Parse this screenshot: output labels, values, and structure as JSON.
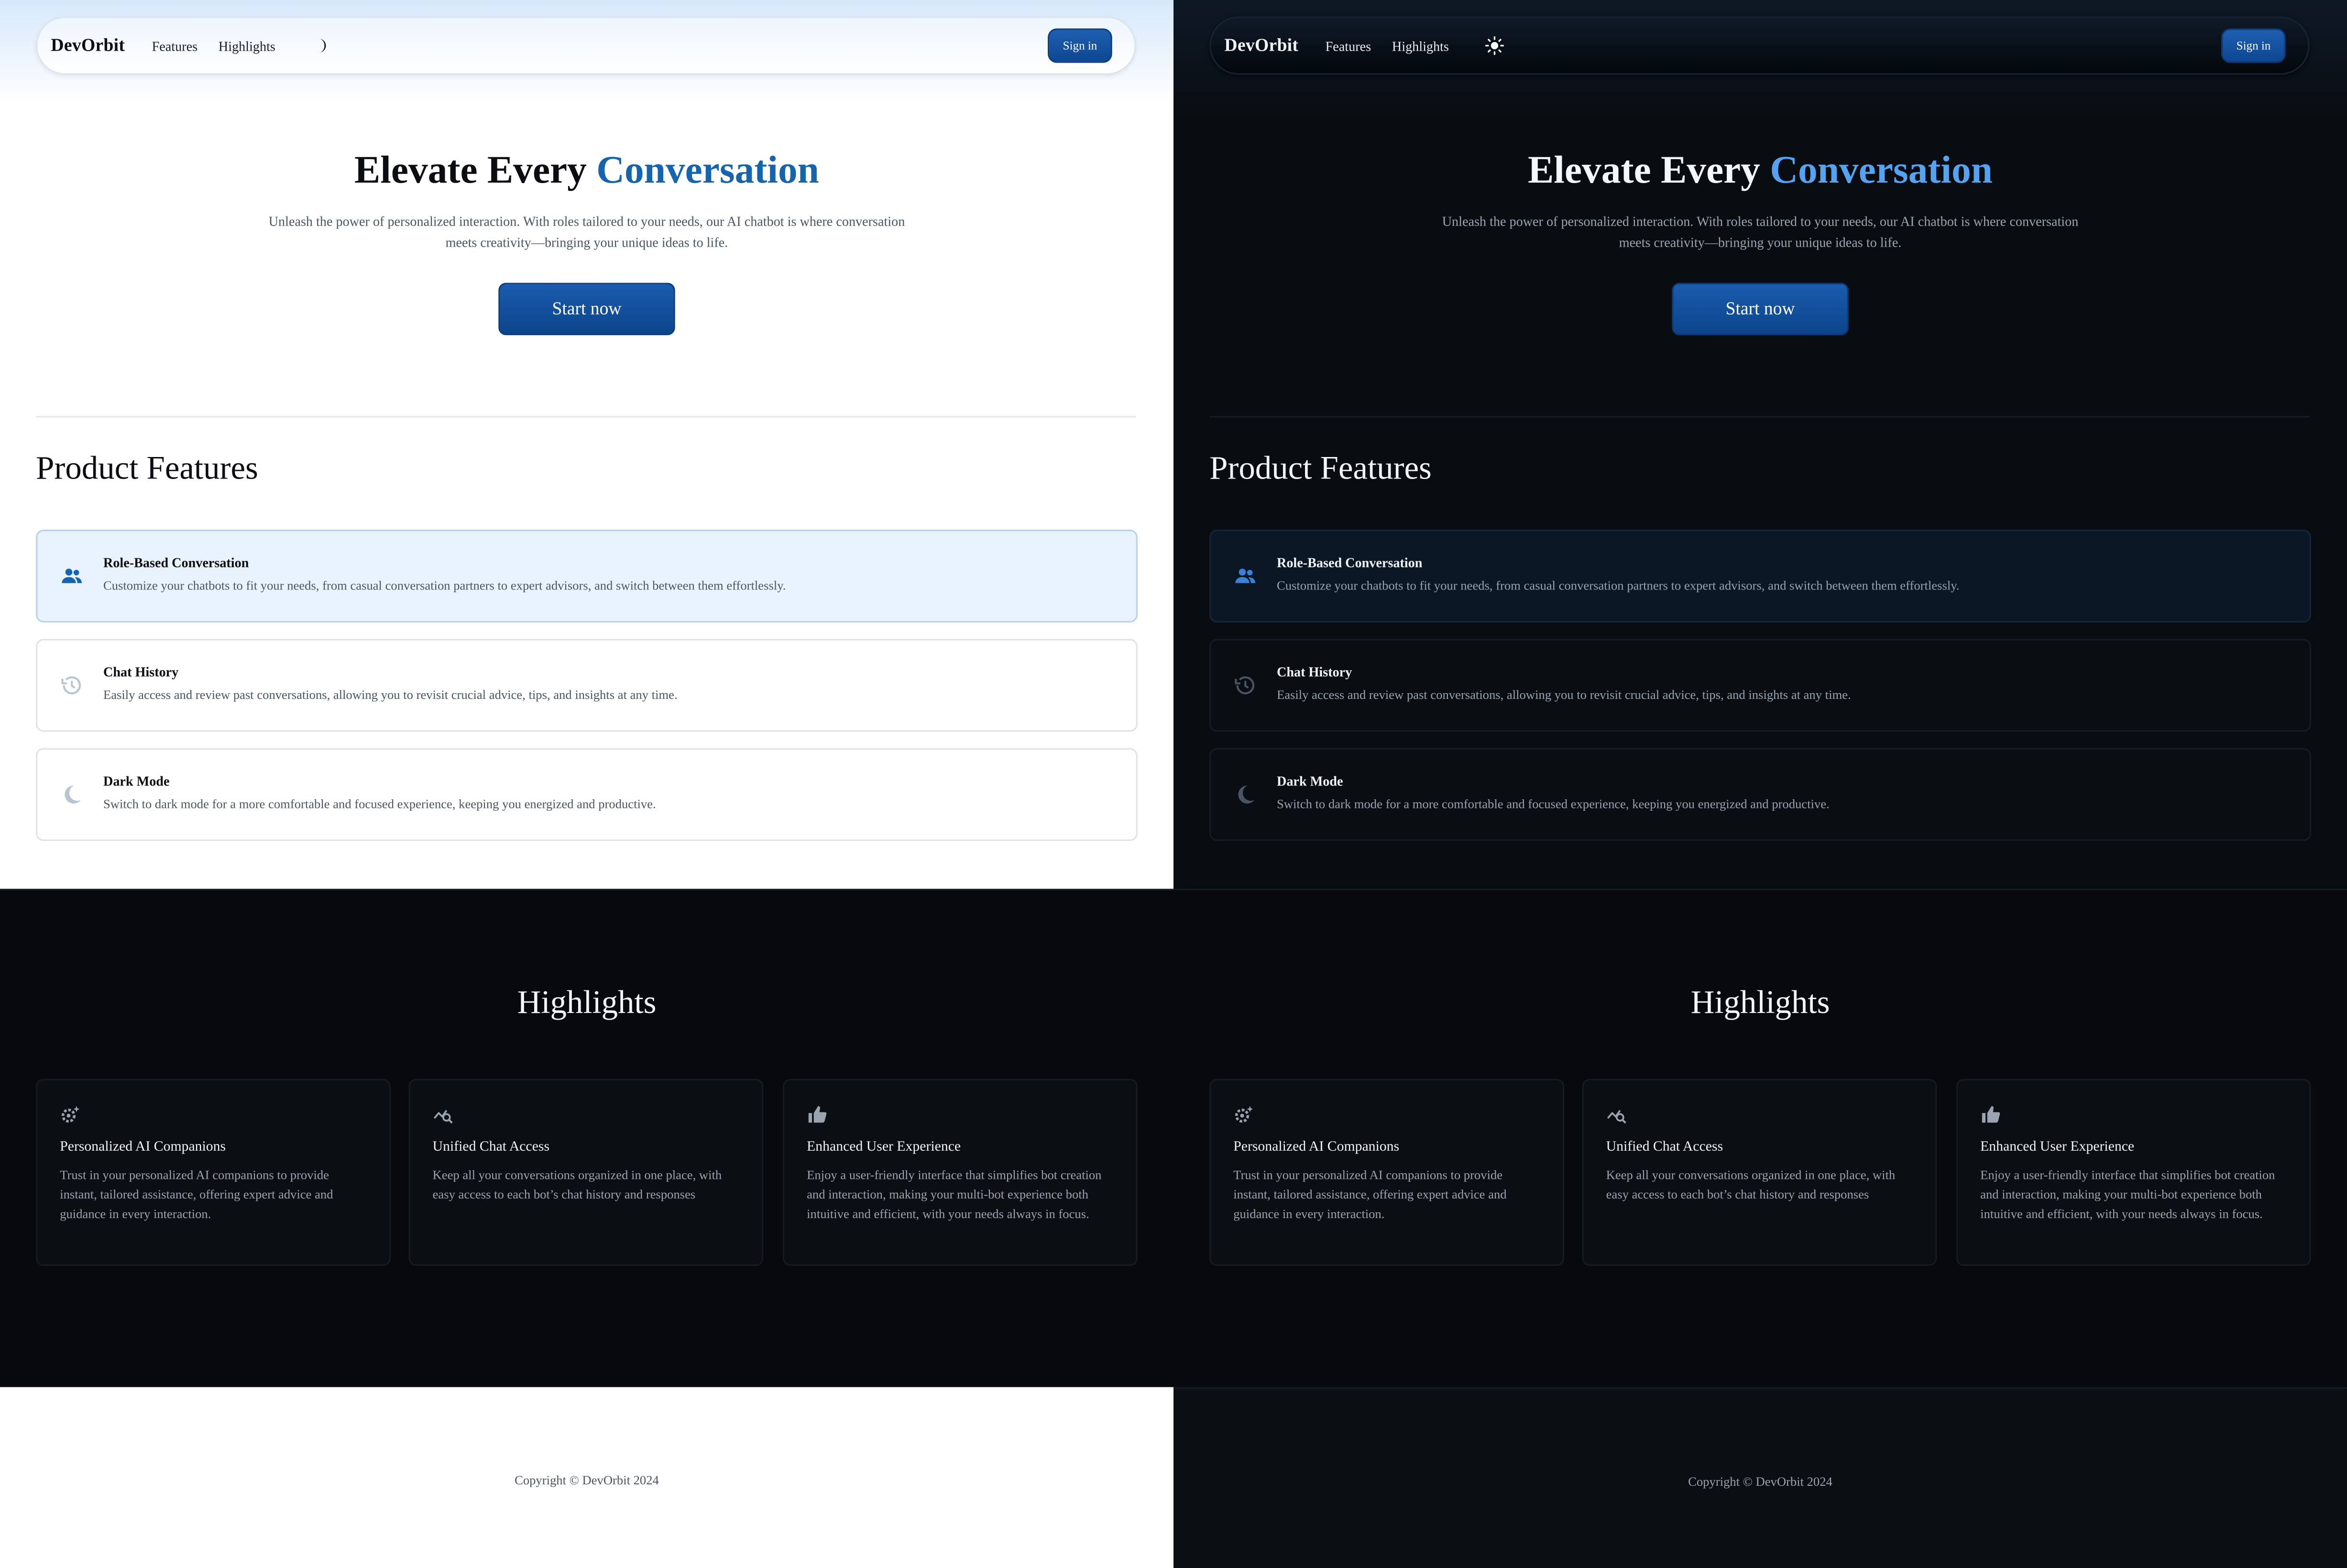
{
  "nav": {
    "brand": "DevOrbit",
    "links": [
      "Features",
      "Highlights"
    ],
    "signin_label": "Sign in",
    "light_mode_toggle_icon": "moon-icon",
    "dark_mode_toggle_icon": "sun-icon"
  },
  "hero": {
    "title_prefix": "Elevate Every ",
    "title_accent": "Conversation",
    "description": "Unleash the power of personalized interaction. With roles tailored to your needs, our AI chatbot is where conversation meets creativity—bringing your unique ideas to life.",
    "cta_label": "Start now"
  },
  "features": {
    "heading": "Product Features",
    "items": [
      {
        "icon": "users-icon",
        "title": "Role-Based Conversation",
        "description": "Customize your chatbots to fit your needs, from casual conversation partners to expert advisors, and switch between them effortlessly.",
        "selected": true
      },
      {
        "icon": "history-icon",
        "title": "Chat History",
        "description": "Easily access and review past conversations, allowing you to revisit crucial advice, tips, and insights at any time.",
        "selected": false
      },
      {
        "icon": "moon-icon",
        "title": "Dark Mode",
        "description": "Switch to dark mode for a more comfortable and focused experience, keeping you energized and productive.",
        "selected": false
      }
    ]
  },
  "highlights": {
    "heading": "Highlights",
    "items": [
      {
        "icon": "settings-sparkle-icon",
        "title": "Personalized AI Companions",
        "description": "Trust in your personalized AI companions to provide instant, tailored assistance, offering expert advice and guidance in every interaction."
      },
      {
        "icon": "query-stats-icon",
        "title": "Unified Chat Access",
        "description": "Keep all your conversations organized in one place, with easy access to each bot’s chat history and responses"
      },
      {
        "icon": "thumbs-up-icon",
        "title": "Enhanced User Experience",
        "description": "Enjoy a user-friendly interface that simplifies bot creation and interaction, making your multi-bot experience both intuitive and efficient, with your needs always in focus."
      }
    ]
  },
  "footer": {
    "copyright": "Copyright © DevOrbit 2024"
  },
  "themes": {
    "light": {
      "accent": "#1664ae",
      "button": "#0d4790",
      "selected_card": "#e9f3fe"
    },
    "dark": {
      "accent": "#55a3f0",
      "button": "#0d4790",
      "background": "#090d12"
    }
  }
}
